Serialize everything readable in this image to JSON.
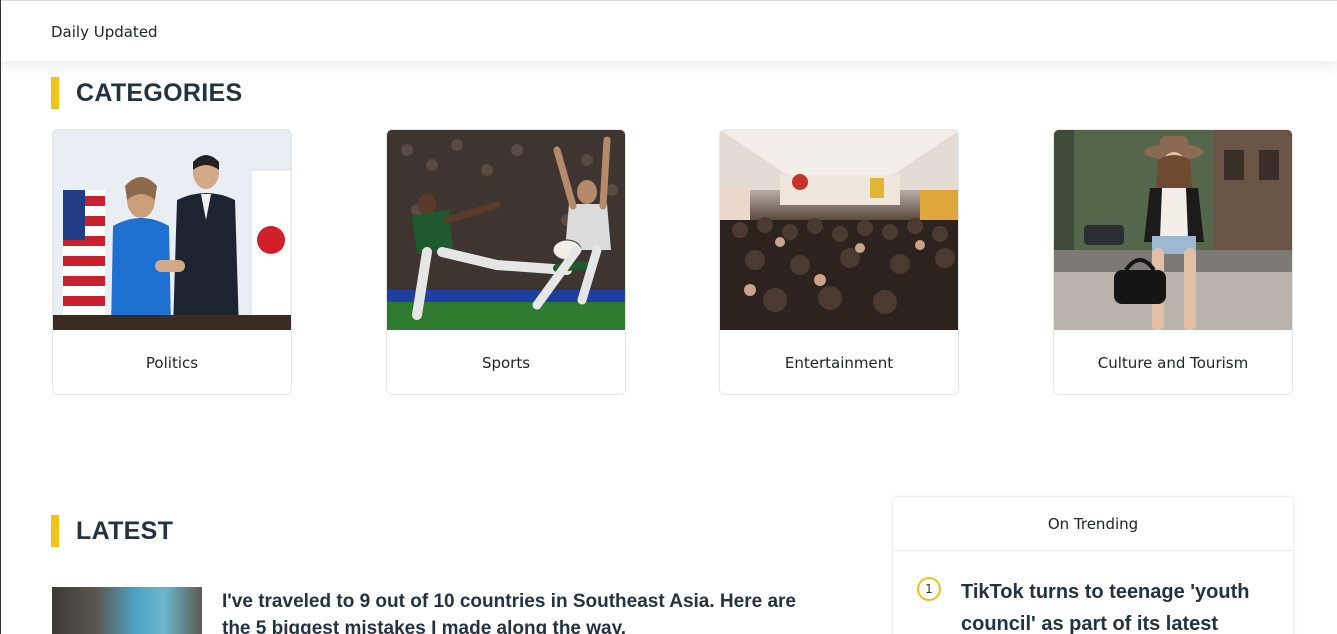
{
  "header": {
    "tagline": "Daily Updated"
  },
  "categories": {
    "title": "CATEGORIES",
    "items": [
      {
        "label": "Politics",
        "image": "politics-photo"
      },
      {
        "label": "Sports",
        "image": "sports-photo"
      },
      {
        "label": "Entertainment",
        "image": "entertainment-photo"
      },
      {
        "label": "Culture and Tourism",
        "image": "culture-photo"
      }
    ]
  },
  "latest": {
    "title": "LATEST",
    "items": [
      {
        "headline": "I've traveled to 9 out of 10 countries in Southeast Asia. Here are the 5 biggest mistakes I made along the way."
      }
    ]
  },
  "trending": {
    "title": "On Trending",
    "items": [
      {
        "rank": "1",
        "headline": "TikTok turns to teenage 'youth council' as part of its latest"
      }
    ]
  },
  "colors": {
    "accent": "#f2c417",
    "heading": "#24333f"
  }
}
